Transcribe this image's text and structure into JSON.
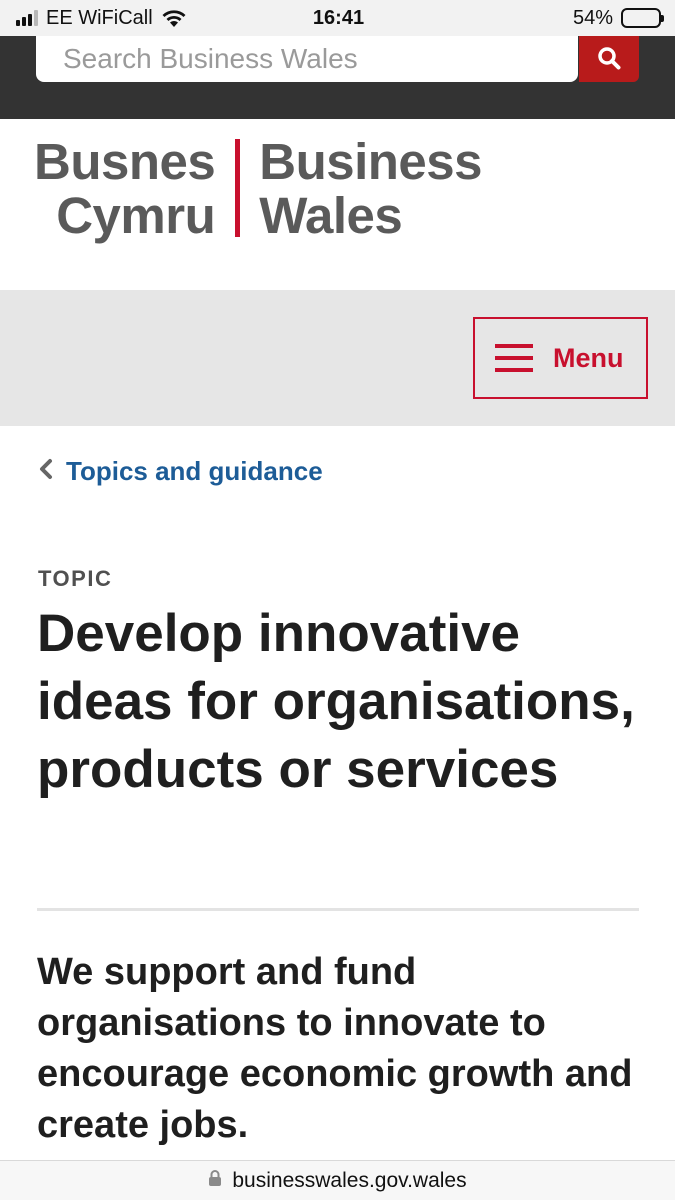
{
  "status_bar": {
    "carrier": "EE WiFiCall",
    "time": "16:41",
    "battery_percent": "54%",
    "battery_level": 0.54,
    "signal_bars_active": 3,
    "signal_bars_total": 4
  },
  "search": {
    "placeholder": "Search Business Wales",
    "button_icon": "search-icon"
  },
  "logo": {
    "welsh_line1": "Busnes",
    "welsh_line2": "Cymru",
    "english_line1": "Business",
    "english_line2": "Wales"
  },
  "nav": {
    "menu_label": "Menu",
    "menu_icon": "hamburger-icon"
  },
  "breadcrumb": {
    "label": "Topics and guidance",
    "icon": "chevron-left-icon"
  },
  "main": {
    "eyebrow": "TOPIC",
    "title": "Develop innovative ideas for organisations, products or services",
    "lead": "We support and fund organisations to innovate to encourage economic growth and create jobs."
  },
  "browser": {
    "url": "businesswales.gov.wales",
    "icon": "lock-icon"
  },
  "colors": {
    "brand_red": "#c8102e",
    "search_red": "#b81b1b",
    "header_dark": "#333333",
    "link_blue": "#1d5c97",
    "band_grey": "#e6e6e6",
    "logo_grey": "#5a5a5a"
  }
}
